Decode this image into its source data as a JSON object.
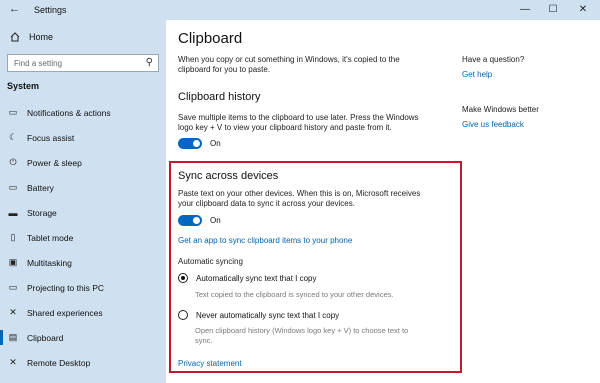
{
  "window": {
    "title": "Settings",
    "back_glyph": "←",
    "controls": {
      "minimize": "—",
      "maximize": "☐",
      "close": "✕"
    }
  },
  "sidebar": {
    "home_label": "Home",
    "search_placeholder": "Find a setting",
    "section_title": "System",
    "items": [
      {
        "label": "Notifications & actions",
        "icon": "notifications-icon",
        "glyph": "▭"
      },
      {
        "label": "Focus assist",
        "icon": "moon-icon",
        "glyph": "☾"
      },
      {
        "label": "Power & sleep",
        "icon": "power-icon",
        "glyph": "⏻"
      },
      {
        "label": "Battery",
        "icon": "battery-icon",
        "glyph": "▭"
      },
      {
        "label": "Storage",
        "icon": "storage-icon",
        "glyph": "▬"
      },
      {
        "label": "Tablet mode",
        "icon": "tablet-icon",
        "glyph": "▯"
      },
      {
        "label": "Multitasking",
        "icon": "multitasking-icon",
        "glyph": "▣"
      },
      {
        "label": "Projecting to this PC",
        "icon": "projecting-icon",
        "glyph": "▭"
      },
      {
        "label": "Shared experiences",
        "icon": "shared-icon",
        "glyph": "✕"
      },
      {
        "label": "Clipboard",
        "icon": "clipboard-icon",
        "glyph": "▤",
        "active": true
      },
      {
        "label": "Remote Desktop",
        "icon": "remote-desktop-icon",
        "glyph": "✕"
      }
    ]
  },
  "main": {
    "title": "Clipboard",
    "intro": "When you copy or cut something in Windows, it's copied to the clipboard for you to paste.",
    "history": {
      "heading": "Clipboard history",
      "description": "Save multiple items to the clipboard to use later. Press the Windows logo key + V to view your clipboard history and paste from it.",
      "toggle_state": "On"
    },
    "sync": {
      "heading": "Sync across devices",
      "description": "Paste text on your other devices. When this is on, Microsoft receives your clipboard data to sync it across your devices.",
      "toggle_state": "On",
      "app_link": "Get an app to sync clipboard items to your phone",
      "auto_label": "Automatic syncing",
      "option_auto": "Automatically sync text that I copy",
      "option_auto_desc": "Text copied to the clipboard is synced to your other devices.",
      "option_never": "Never automatically sync text that I copy",
      "option_never_desc": "Open clipboard history (Windows logo key + V) to choose text to sync."
    },
    "privacy_link": "Privacy statement"
  },
  "aside": {
    "question_heading": "Have a question?",
    "help_link": "Get help",
    "better_heading": "Make Windows better",
    "feedback_link": "Give us feedback"
  },
  "colors": {
    "accent": "#0067c0",
    "sidebar_bg": "#cfe0f0",
    "highlight_border": "#c01b2c"
  }
}
